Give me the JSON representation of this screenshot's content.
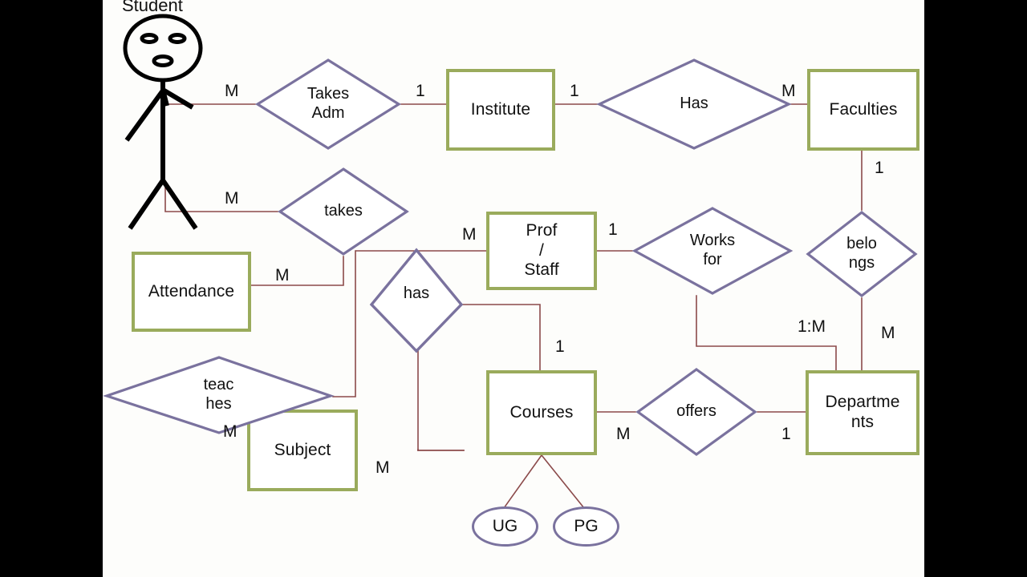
{
  "diagram": {
    "title": "Student",
    "colors": {
      "entity_border": "#9aab5c",
      "relationship_border": "#7a729e",
      "attribute_border": "#7a729e",
      "connector": "#8b4a4a",
      "actor": "#000000",
      "canvas": "#fdfdfb",
      "letterbox": "#000000"
    },
    "actor": {
      "name": "Student",
      "label": "Student"
    },
    "entities": [
      {
        "id": "institute",
        "label": "Institute"
      },
      {
        "id": "faculties",
        "label": "Faculties"
      },
      {
        "id": "prof_staff",
        "label": "Prof\n/\nStaff"
      },
      {
        "id": "attendance",
        "label": "Attendance"
      },
      {
        "id": "subject",
        "label": "Subject"
      },
      {
        "id": "courses",
        "label": "Courses"
      },
      {
        "id": "departments",
        "label": "Departme\nnts"
      }
    ],
    "relationships": [
      {
        "id": "takes_adm",
        "label": "Takes\nAdm"
      },
      {
        "id": "has_top",
        "label": "Has"
      },
      {
        "id": "takes",
        "label": "takes"
      },
      {
        "id": "works_for",
        "label": "Works\nfor"
      },
      {
        "id": "belongs",
        "label": "belo\nngs"
      },
      {
        "id": "teaches",
        "label": "teac\nhes"
      },
      {
        "id": "has_mid",
        "label": "has"
      },
      {
        "id": "offers",
        "label": "offers"
      }
    ],
    "attributes": [
      {
        "id": "ug",
        "label": "UG"
      },
      {
        "id": "pg",
        "label": "PG"
      }
    ],
    "cardinalities": [
      {
        "id": "student_takesadm",
        "label": "M"
      },
      {
        "id": "takesadm_institute",
        "label": "1"
      },
      {
        "id": "institute_has",
        "label": "1"
      },
      {
        "id": "has_faculties",
        "label": "M"
      },
      {
        "id": "faculties_belongs",
        "label": "1"
      },
      {
        "id": "student_takes",
        "label": "M"
      },
      {
        "id": "takes_attendance",
        "label": "M"
      },
      {
        "id": "takes_profstaff",
        "label": "M"
      },
      {
        "id": "profstaff_worksfor",
        "label": "1"
      },
      {
        "id": "worksfor_departments",
        "label": "1:M"
      },
      {
        "id": "belongs_departments",
        "label": "M"
      },
      {
        "id": "has_courses",
        "label": "1"
      },
      {
        "id": "has_subject",
        "label": "M"
      },
      {
        "id": "teaches_subject",
        "label": "M"
      },
      {
        "id": "courses_offers",
        "label": "M"
      },
      {
        "id": "offers_departments",
        "label": "1"
      }
    ]
  }
}
